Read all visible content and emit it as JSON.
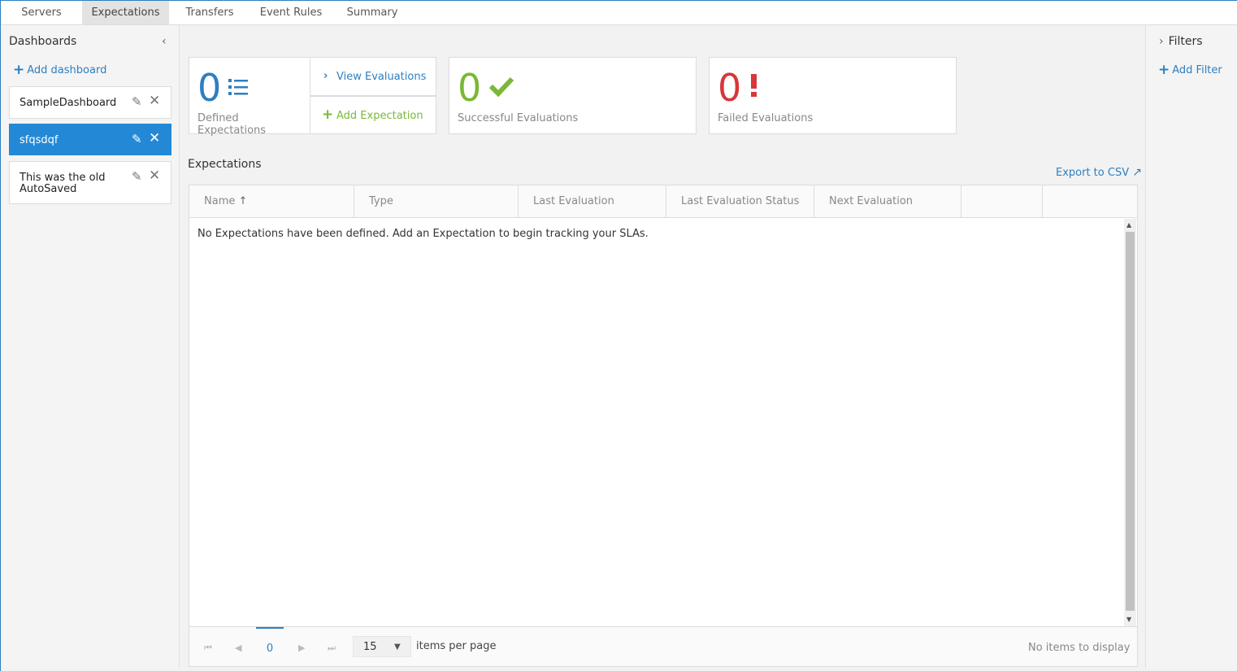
{
  "tabs": [
    "Servers",
    "Expectations",
    "Transfers",
    "Event Rules",
    "Summary"
  ],
  "sidebar": {
    "title": "Dashboards",
    "add_label": "Add dashboard",
    "items": [
      {
        "name": "SampleDashboard"
      },
      {
        "name": "sfqsdqf"
      },
      {
        "name_line1": "This was the old",
        "name_line2": "AutoSaved"
      }
    ]
  },
  "filters": {
    "title": "Filters",
    "add_label": "Add Filter"
  },
  "cards": {
    "defined": {
      "value": "0",
      "label": "Defined Expectations"
    },
    "success": {
      "value": "0",
      "label": "Successful Evaluations"
    },
    "failed": {
      "value": "0",
      "label": "Failed Evaluations"
    }
  },
  "actions": {
    "view": "View Evaluations",
    "add": "Add Expectation"
  },
  "section": {
    "title": "Expectations",
    "export": "Export to CSV"
  },
  "grid": {
    "columns": [
      "Name",
      "Type",
      "Last Evaluation",
      "Last Evaluation Status",
      "Next Evaluation"
    ],
    "empty_message": "No Expectations have been defined. Add an Expectation to begin tracking your SLAs.",
    "pager": {
      "page": "0",
      "page_size": "15",
      "items_per_page": "items per page",
      "no_items": "No items to display"
    }
  },
  "colors": {
    "accent": "#2d7fc1",
    "success": "#7ab835",
    "failed": "#d9363a"
  }
}
